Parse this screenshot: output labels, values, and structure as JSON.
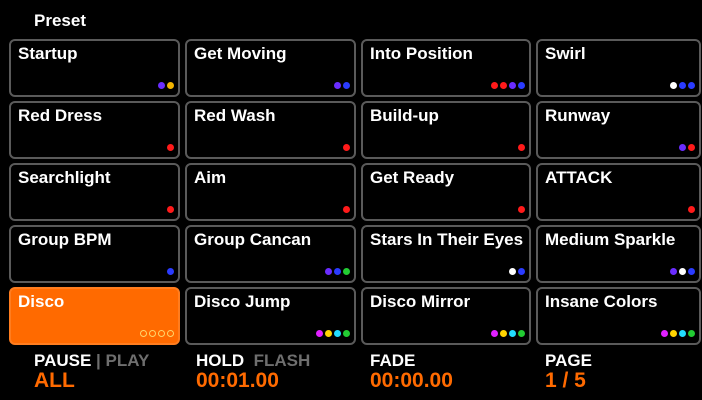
{
  "header": {
    "title": "Preset"
  },
  "presets": [
    {
      "label": "Startup",
      "dots": [
        "#6a2cff",
        "#f3b400"
      ]
    },
    {
      "label": "Get Moving",
      "dots": [
        "#6a2cff",
        "#2a3bff"
      ]
    },
    {
      "label": "Into Position",
      "dots": [
        "#ff1a1a",
        "#ff1a1a",
        "#6a2cff",
        "#2a3bff"
      ]
    },
    {
      "label": "Swirl",
      "dots": [
        "#ffffff",
        "#2a3bff",
        "#2a3bff"
      ]
    },
    {
      "label": "Red Dress",
      "dots": [
        "#ff1a1a"
      ]
    },
    {
      "label": "Red Wash",
      "dots": [
        "#ff1a1a"
      ]
    },
    {
      "label": "Build-up",
      "dots": [
        "#ff1a1a"
      ]
    },
    {
      "label": "Runway",
      "dots": [
        "#6a2cff",
        "#ff1a1a"
      ]
    },
    {
      "label": "Searchlight",
      "dots": [
        "#ff1a1a"
      ]
    },
    {
      "label": "Aim",
      "dots": [
        "#ff1a1a"
      ]
    },
    {
      "label": "Get Ready",
      "dots": [
        "#ff1a1a"
      ]
    },
    {
      "label": "ATTACK",
      "dots": [
        "#ff1a1a"
      ]
    },
    {
      "label": "Group BPM",
      "dots": [
        "#2a3bff"
      ]
    },
    {
      "label": "Group Cancan",
      "dots": [
        "#6a2cff",
        "#2a3bff",
        "#22cc33"
      ]
    },
    {
      "label": "Stars In Their Eyes",
      "dots": [
        "#ffffff",
        "#2a3bff"
      ]
    },
    {
      "label": "Medium Sparkle",
      "dots": [
        "#6a2cff",
        "#ffffff",
        "#2a3bff"
      ]
    },
    {
      "label": "Disco",
      "dots": [
        "ring",
        "ring",
        "ring",
        "ring"
      ],
      "active": true
    },
    {
      "label": "Disco Jump",
      "dots": [
        "#e020ff",
        "#ffd400",
        "#22ddff",
        "#22cc33"
      ]
    },
    {
      "label": "Disco Mirror",
      "dots": [
        "#e020ff",
        "#ffd400",
        "#22ddff",
        "#22cc33"
      ]
    },
    {
      "label": "Insane Colors",
      "dots": [
        "#e020ff",
        "#ffd400",
        "#22ddff",
        "#22cc33"
      ]
    }
  ],
  "footer": {
    "pause": {
      "label_active": "PAUSE",
      "separator": "|",
      "label_inactive": "PLAY",
      "value": "ALL"
    },
    "hold": {
      "label_active": "HOLD",
      "label_inactive": "FLASH",
      "value": "00:01.00"
    },
    "fade": {
      "label": "FADE",
      "value": "00:00.00"
    },
    "page": {
      "label": "PAGE",
      "value": "1 / 5"
    }
  },
  "colors": {
    "accent": "#ff6a00",
    "tile_border": "#5a5a5a",
    "muted": "#6e6e6e"
  }
}
